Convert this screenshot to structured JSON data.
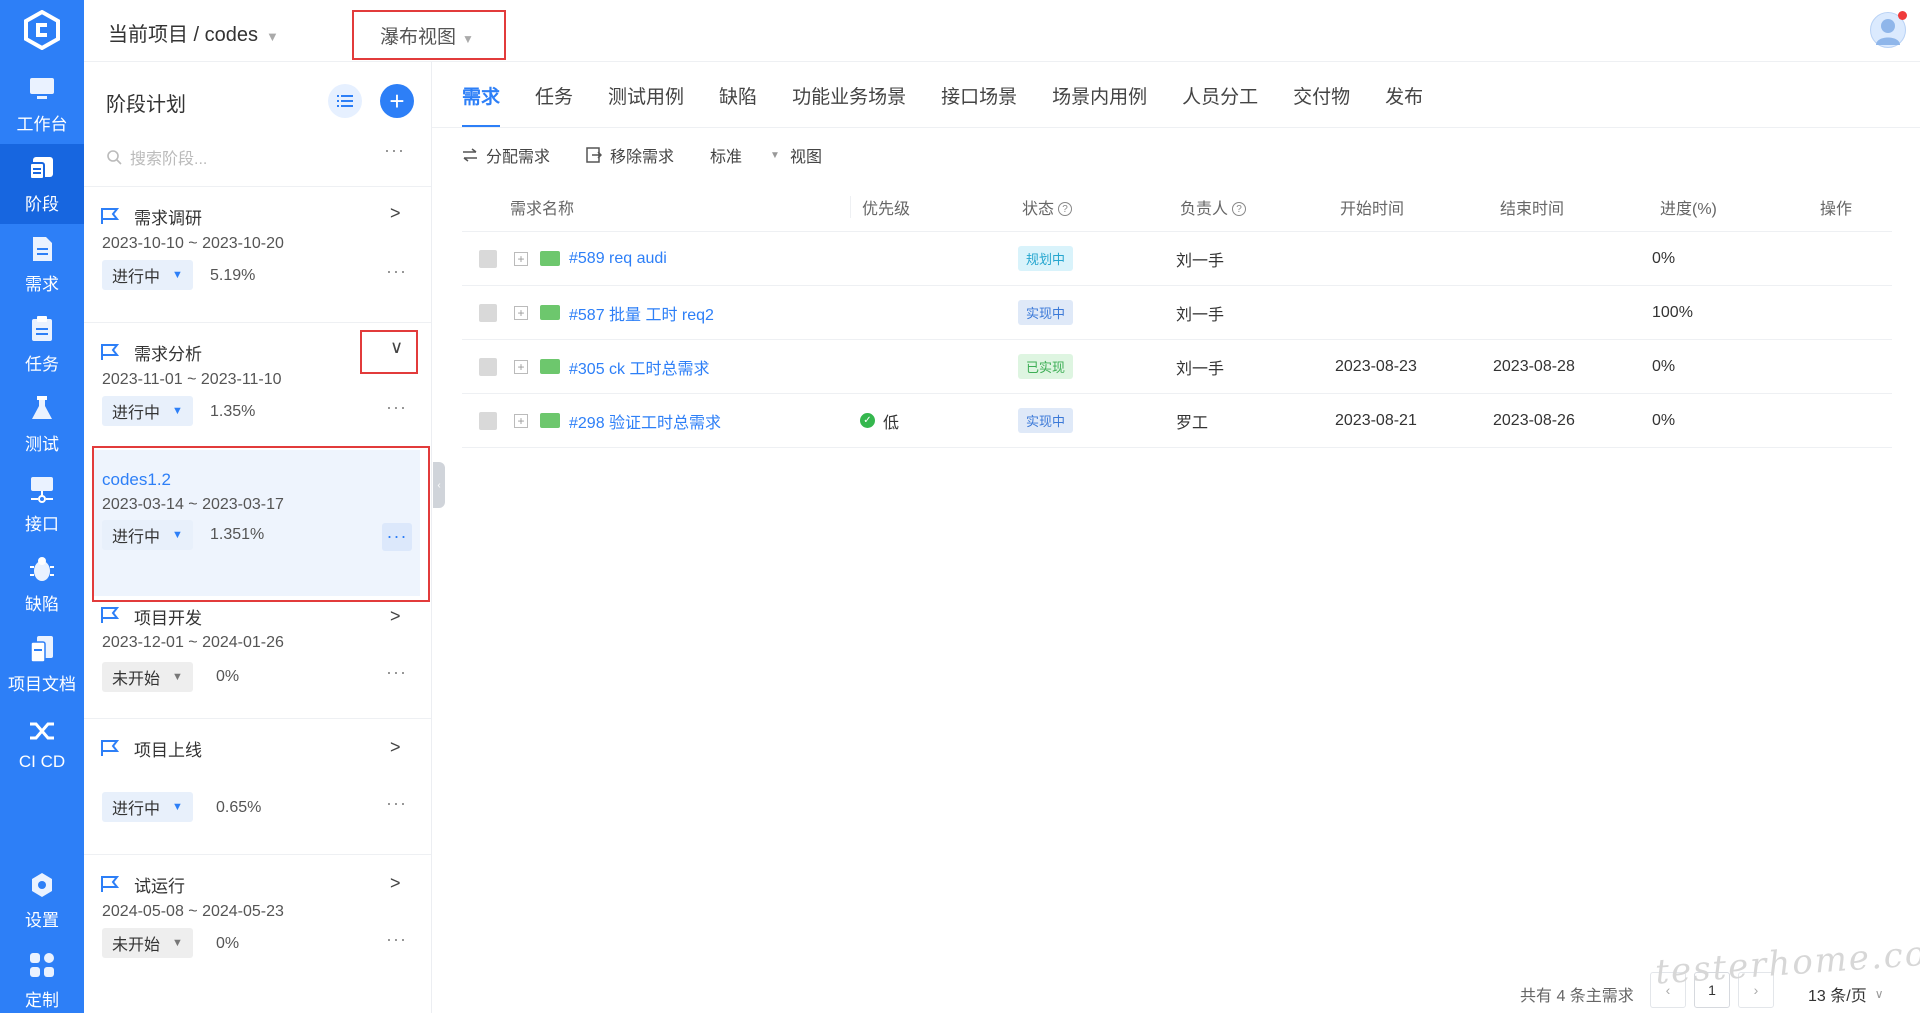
{
  "nav": {
    "items": [
      {
        "label": "工作台",
        "icon": "monitor-icon"
      },
      {
        "label": "阶段",
        "icon": "stage-icon"
      },
      {
        "label": "需求",
        "icon": "document-icon"
      },
      {
        "label": "任务",
        "icon": "clipboard-icon"
      },
      {
        "label": "测试",
        "icon": "flask-icon"
      },
      {
        "label": "接口",
        "icon": "api-icon"
      },
      {
        "label": "缺陷",
        "icon": "bug-icon"
      },
      {
        "label": "项目文档",
        "icon": "file-icon"
      },
      {
        "label": "CI CD",
        "icon": "cicd-icon"
      },
      {
        "label": "设置",
        "icon": "settings-icon"
      },
      {
        "label": "定制",
        "icon": "grid-icon"
      }
    ],
    "active_index": 1
  },
  "header": {
    "breadcrumb": "当前项目 / codes",
    "view_selector": "瀑布视图"
  },
  "stages": {
    "title": "阶段计划",
    "search_placeholder": "搜索阶段...",
    "more": "···",
    "items": [
      {
        "name": "需求调研",
        "dates": "2023-10-10 ~ 2023-10-20",
        "status": "进行中",
        "progress": "5.19%",
        "expand": ">"
      },
      {
        "name": "需求分析",
        "dates": "2023-11-01 ~ 2023-11-10",
        "status": "进行中",
        "progress": "1.35%",
        "expand": "∨"
      },
      {
        "name": "codes1.2",
        "dates": "2023-03-14 ~ 2023-03-17",
        "status": "进行中",
        "progress": "1.351%",
        "expand": ""
      },
      {
        "name": "项目开发",
        "dates": "2023-12-01 ~ 2024-01-26",
        "status": "未开始",
        "progress": "0%",
        "expand": ">"
      },
      {
        "name": "项目上线",
        "dates": "",
        "status": "进行中",
        "progress": "0.65%",
        "expand": ">"
      },
      {
        "name": "试运行",
        "dates": "2024-05-08 ~ 2024-05-23",
        "status": "未开始",
        "progress": "0%",
        "expand": ">"
      }
    ]
  },
  "tabs": [
    "需求",
    "任务",
    "测试用例",
    "缺陷",
    "功能业务场景",
    "接口场景",
    "场景内用例",
    "人员分工",
    "交付物",
    "发布"
  ],
  "toolbar": {
    "assign": "分配需求",
    "remove": "移除需求",
    "standard": "标准",
    "view": "视图"
  },
  "table": {
    "headers": {
      "name": "需求名称",
      "priority": "优先级",
      "status": "状态",
      "owner": "负责人",
      "start": "开始时间",
      "end": "结束时间",
      "progress": "进度(%)",
      "action": "操作"
    },
    "rows": [
      {
        "name": "#589 req audi",
        "priority": "",
        "status": "规划中",
        "status_kind": "plan",
        "owner": "刘一手",
        "start": "",
        "end": "",
        "progress": "0%"
      },
      {
        "name": "#587 批量 工时 req2",
        "priority": "",
        "status": "实现中",
        "status_kind": "doing",
        "owner": "刘一手",
        "start": "",
        "end": "",
        "progress": "100%"
      },
      {
        "name": "#305 ck 工时总需求",
        "priority": "",
        "status": "已实现",
        "status_kind": "done",
        "owner": "刘一手",
        "start": "2023-08-23",
        "end": "2023-08-28",
        "progress": "0%"
      },
      {
        "name": "#298 验证工时总需求",
        "priority": "低",
        "status": "实现中",
        "status_kind": "doing",
        "owner": "罗工",
        "start": "2023-08-21",
        "end": "2023-08-26",
        "progress": "0%"
      }
    ]
  },
  "footer": {
    "total": "共有 4 条主需求",
    "page": "1",
    "page_size": "13 条/页"
  },
  "watermark": "testerhome.com",
  "colors": {
    "accent": "#2d7ff7",
    "highlight": "#e23b3b"
  }
}
